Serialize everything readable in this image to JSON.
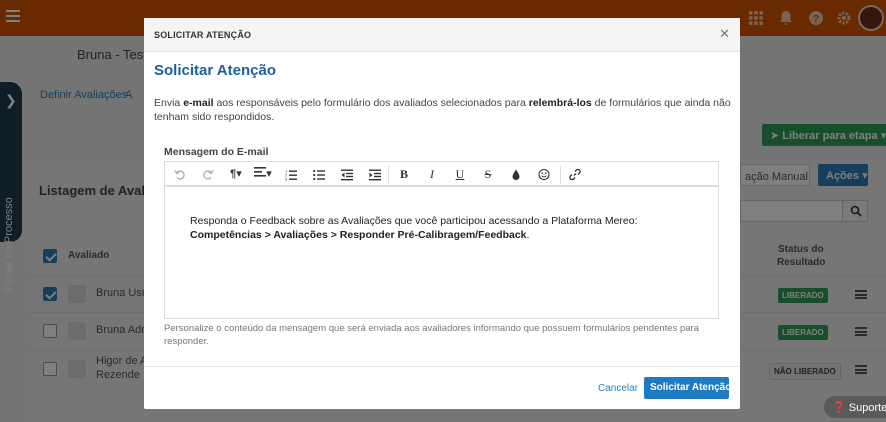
{
  "app": {
    "subject_name": "Bruna - Teste",
    "tabs": [
      "Definir Avaliações",
      "A"
    ],
    "side_panel_label": "Painel de Processo",
    "list_title": "Listagem de Avaliad",
    "release_button": "Liberar para etapa",
    "release_mode": "ação Manual",
    "actions_button": "Ações",
    "column_evaluated": "Avaliado",
    "column_status_line1": "Status do",
    "column_status_line2": "Resultado",
    "rows": [
      {
        "name": "Bruna Usu",
        "checked": true,
        "status": "LIBERADO"
      },
      {
        "name": "Bruna Adm",
        "checked": false,
        "status": "LIBERADO"
      },
      {
        "name": "Higor de Ar",
        "name2": "Rezende",
        "checked": false,
        "status": "NÃO LIBERADO"
      }
    ],
    "support_label": "Suporte"
  },
  "modal": {
    "header_title": "SOLICITAR ATENÇÃO",
    "title": "Solicitar Atenção",
    "desc_1": "Envia ",
    "desc_bold_1": "e-mail",
    "desc_2": " aos responsáveis pelo formulário dos avaliados selecionados para ",
    "desc_bold_2": "relembrá-los",
    "desc_3": " de formulários que ainda não tenham sido respondidos.",
    "field_label": "Mensagem do E-mail",
    "message_text": "Responda o Feedback sobre as Avaliações que você participou acessando a Plataforma Mereo: ",
    "message_bold": "Competências > Avaliações > Responder Pré-Calibragem/Feedback",
    "message_end": ".",
    "hint": "Personalize o conteúdo da mensagem que será enviada aos avaliadores informando que possuem formulários pendentes para responder.",
    "cancel_label": "Cancelar",
    "submit_label": "Solicitar Atenção"
  },
  "colors": {
    "topbar": "#d35400",
    "primary": "#1f7ac4",
    "title": "#1f5f9e",
    "success": "#2e9e5b"
  }
}
